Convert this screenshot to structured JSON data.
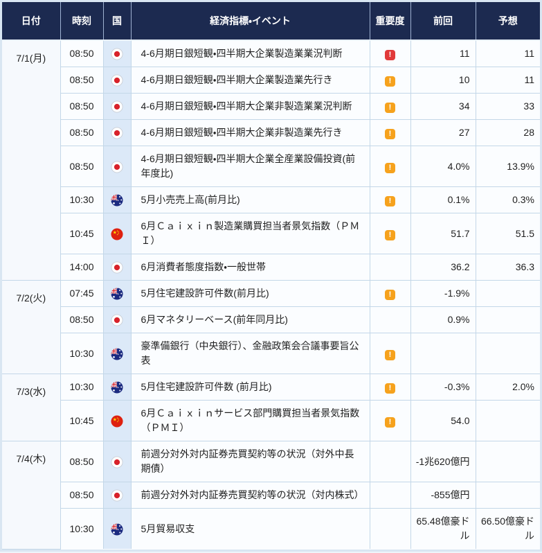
{
  "header": {
    "date": "日付",
    "time": "時刻",
    "country": "国",
    "event": "経済指標・イベント",
    "importance": "重要度",
    "previous": "前回",
    "forecast": "予想"
  },
  "icons": {
    "importance_glyph": "!",
    "importance_high_icon": "red-exclamation-badge",
    "importance_medium_icon": "orange-exclamation-badge",
    "flag_icons": [
      "japan-flag",
      "australia-flag",
      "china-flag"
    ]
  },
  "colors": {
    "header_bg": "#1c2a50",
    "header_text": "#ffffff",
    "row_bg": "#fbfdff",
    "date_col_bg": "#f6f9fd",
    "country_col_bg": "#dce9f8",
    "border": "#c3d7e8",
    "outer_border": "#d9e6f2",
    "importance_high": "#e13a3a",
    "importance_medium": "#f6a21d",
    "text": "#1f1f1f"
  },
  "rows": [
    {
      "date": "7/1(月)",
      "date_rowspan": 8,
      "time": "08:50",
      "country": "japan",
      "event": "4-6月期日銀短観・四半期大企業製造業業況判断",
      "importance": "high",
      "previous": "11",
      "forecast": "11"
    },
    {
      "time": "08:50",
      "country": "japan",
      "event": "4-6月期日銀短観・四半期大企業製造業先行き",
      "importance": "medium",
      "previous": "10",
      "forecast": "11"
    },
    {
      "time": "08:50",
      "country": "japan",
      "event": "4-6月期日銀短観・四半期大企業非製造業業況判断",
      "importance": "medium",
      "previous": "34",
      "forecast": "33"
    },
    {
      "time": "08:50",
      "country": "japan",
      "event": "4-6月期日銀短観・四半期大企業非製造業先行き",
      "importance": "medium",
      "previous": "27",
      "forecast": "28"
    },
    {
      "time": "08:50",
      "country": "japan",
      "event": "4-6月期日銀短観・四半期大企業全産業設備投資(前年度比)",
      "importance": "medium",
      "previous": "4.0%",
      "forecast": "13.9%"
    },
    {
      "time": "10:30",
      "country": "australia",
      "event": "5月小売売上高(前月比)",
      "importance": "medium",
      "previous": "0.1%",
      "forecast": "0.3%"
    },
    {
      "time": "10:45",
      "country": "china",
      "event": "6月Ｃａｉｘｉｎ製造業購買担当者景気指数（ＰＭＩ）",
      "importance": "medium",
      "previous": "51.7",
      "forecast": "51.5"
    },
    {
      "time": "14:00",
      "country": "japan",
      "event": "6月消費者態度指数・一般世帯",
      "importance": "",
      "previous": "36.2",
      "forecast": "36.3"
    },
    {
      "date": "7/2(火)",
      "date_rowspan": 3,
      "time": "07:45",
      "country": "australia",
      "event": "5月住宅建設許可件数(前月比)",
      "importance": "medium",
      "previous": "-1.9%",
      "forecast": ""
    },
    {
      "time": "08:50",
      "country": "japan",
      "event": "6月マネタリーベース(前年同月比)",
      "importance": "",
      "previous": "0.9%",
      "forecast": ""
    },
    {
      "time": "10:30",
      "country": "australia",
      "event": "豪準備銀行（中央銀行）、金融政策会合議事要旨公表",
      "importance": "medium",
      "previous": "",
      "forecast": ""
    },
    {
      "date": "7/3(水)",
      "date_rowspan": 2,
      "time": "10:30",
      "country": "australia",
      "event": "5月住宅建設許可件数 (前月比)",
      "importance": "medium",
      "previous": "-0.3%",
      "forecast": "2.0%"
    },
    {
      "time": "10:45",
      "country": "china",
      "event": "6月Ｃａｉｘｉｎサービス部門購買担当者景気指数（ＰＭＩ）",
      "importance": "medium",
      "previous": "54.0",
      "forecast": ""
    },
    {
      "date": "7/4(木)",
      "date_rowspan": 3,
      "time": "08:50",
      "country": "japan",
      "event": "前週分対外対内証券売買契約等の状況（対外中長期債）",
      "importance": "",
      "previous": "-1兆620億円",
      "forecast": ""
    },
    {
      "time": "08:50",
      "country": "japan",
      "event": "前週分対外対内証券売買契約等の状況（対内株式）",
      "importance": "",
      "previous": "-855億円",
      "forecast": ""
    },
    {
      "time": "10:30",
      "country": "australia",
      "event": "5月貿易収支",
      "importance": "",
      "previous": "65.48億豪ドル",
      "forecast": "66.50億豪ドル"
    }
  ]
}
